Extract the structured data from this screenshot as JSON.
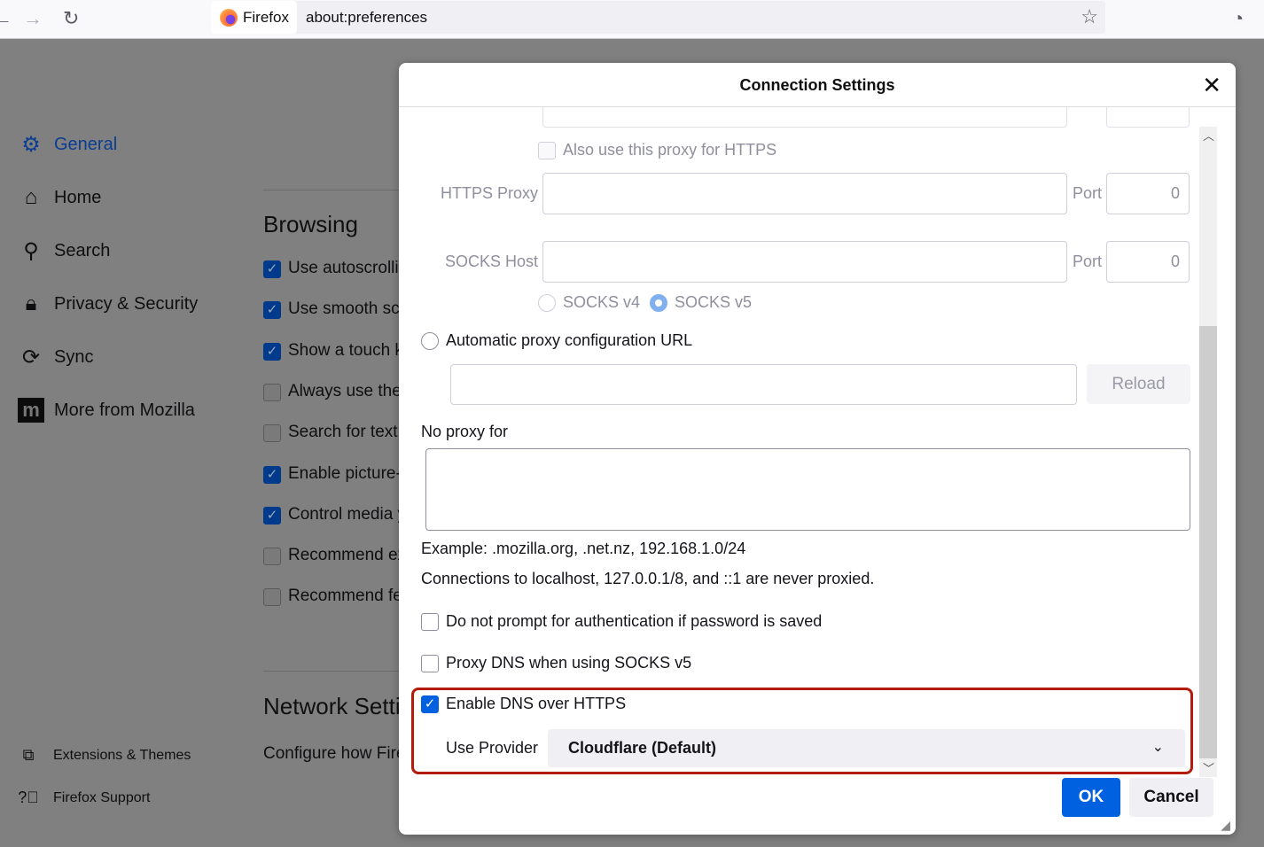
{
  "browser": {
    "identity": "Firefox",
    "url": "about:preferences"
  },
  "sidebar": {
    "items": [
      {
        "label": "General",
        "icon": "gear-icon",
        "active": true
      },
      {
        "label": "Home",
        "icon": "home-icon"
      },
      {
        "label": "Search",
        "icon": "search-icon"
      },
      {
        "label": "Privacy & Security",
        "icon": "lock-icon"
      },
      {
        "label": "Sync",
        "icon": "sync-icon"
      },
      {
        "label": "More from Mozilla",
        "icon": "mozilla-icon"
      }
    ],
    "footer": [
      {
        "label": "Extensions & Themes",
        "icon": "puzzle-icon"
      },
      {
        "label": "Firefox Support",
        "icon": "help-icon"
      }
    ]
  },
  "main": {
    "browsing_heading": "Browsing",
    "options": [
      {
        "label": "Use autoscrollin",
        "checked": true
      },
      {
        "label": "Use smooth scr",
        "checked": true
      },
      {
        "label": "Show a touch k",
        "checked": true
      },
      {
        "label": "Always use the",
        "checked": false
      },
      {
        "label": "Search for text",
        "checked": false
      },
      {
        "label": "Enable picture-",
        "checked": true
      },
      {
        "label": "Control media y",
        "checked": true
      },
      {
        "label": "Recommend ex",
        "checked": false
      },
      {
        "label": "Recommend fe",
        "checked": false
      }
    ],
    "network_heading": "Network Setti",
    "network_desc": "Configure how Fire"
  },
  "dialog": {
    "title": "Connection Settings",
    "also_https": "Also use this proxy for HTTPS",
    "https_proxy_label": "HTTPS Proxy",
    "https_port_label": "Port",
    "https_port": "0",
    "socks_host_label": "SOCKS Host",
    "socks_port_label": "Port",
    "socks_port": "0",
    "socks_v4": "SOCKS v4",
    "socks_v5": "SOCKS v5",
    "socks_selected": "SOCKS v5",
    "auto_proxy_label": "Automatic proxy configuration URL",
    "auto_proxy_url": "",
    "reload": "Reload",
    "no_proxy_label": "No proxy for",
    "no_proxy_value": "",
    "example": "Example: .mozilla.org, .net.nz, 192.168.1.0/24",
    "localhost_note": "Connections to localhost, 127.0.0.1/8, and ::1 are never proxied.",
    "no_auth_prompt": {
      "label": "Do not prompt for authentication if password is saved",
      "checked": false
    },
    "proxy_dns": {
      "label": "Proxy DNS when using SOCKS v5",
      "checked": false
    },
    "doh": {
      "label": "Enable DNS over HTTPS",
      "checked": true
    },
    "provider_label": "Use Provider",
    "provider_value": "Cloudflare (Default)",
    "ok": "OK",
    "cancel": "Cancel",
    "colors": {
      "accent": "#0061e0",
      "highlight_box": "#b31b0b"
    }
  }
}
